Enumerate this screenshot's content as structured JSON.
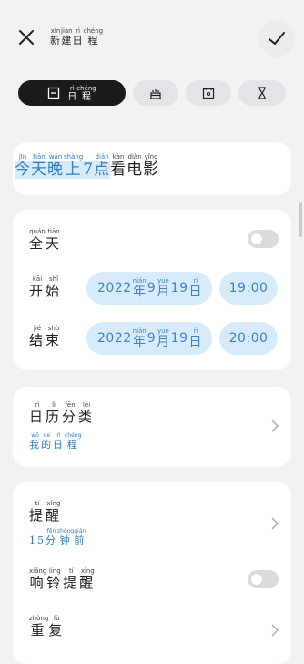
{
  "header": {
    "title": [
      {
        "hanzi": "新",
        "pinyin": "xīn"
      },
      {
        "hanzi": "建",
        "pinyin": "jiàn"
      },
      {
        "hanzi": "日",
        "pinyin": "rì"
      },
      {
        "hanzi": "程",
        "pinyin": "chéng"
      }
    ],
    "close_icon": "close-icon",
    "confirm_icon": "check-icon"
  },
  "tabs": {
    "active_label": "日程",
    "items": [
      {
        "icon": "calendar-square-icon",
        "active": true
      },
      {
        "icon": "birthday-cake-icon",
        "active": false
      },
      {
        "icon": "anniversary-calendar-icon",
        "active": false
      },
      {
        "icon": "hourglass-icon",
        "active": false
      }
    ]
  },
  "event": {
    "title_highlighted": [
      {
        "hanzi": "今",
        "pinyin": "jīn"
      },
      {
        "hanzi": "天",
        "pinyin": "tiān"
      },
      {
        "hanzi": "晚",
        "pinyin": "wǎn"
      },
      {
        "hanzi": "上",
        "pinyin": "shàng"
      },
      {
        "hanzi": "7",
        "pinyin": ""
      },
      {
        "hanzi": "点",
        "pinyin": "diǎn"
      }
    ],
    "title_rest": [
      {
        "hanzi": "看",
        "pinyin": "kàn"
      },
      {
        "hanzi": "电",
        "pinyin": "diàn"
      },
      {
        "hanzi": "影",
        "pinyin": "yǐng"
      }
    ]
  },
  "time": {
    "all_day": [
      {
        "hanzi": "全",
        "pinyin": "quán"
      },
      {
        "hanzi": "天",
        "pinyin": "tiān"
      }
    ],
    "start_label": [
      {
        "hanzi": "开",
        "pinyin": "kāi"
      },
      {
        "hanzi": "始",
        "pinyin": "shǐ"
      }
    ],
    "end_label": [
      {
        "hanzi": "结",
        "pinyin": "jié"
      },
      {
        "hanzi": "束",
        "pinyin": "shù"
      }
    ],
    "start_date": {
      "year": "2022",
      "y": "年",
      "m_num": "9",
      "m": "月",
      "d_num": "19",
      "d": "日",
      "y_py": "nián",
      "m_py": "yuè",
      "d_py": "rì"
    },
    "start_time": "19:00",
    "end_date": {
      "year": "2022",
      "y": "年",
      "m_num": "9",
      "m": "月",
      "d_num": "19",
      "d": "日",
      "y_py": "nián",
      "m_py": "yuè",
      "d_py": "rì"
    },
    "end_time": "20:00",
    "all_day_on": false
  },
  "category": {
    "label": [
      {
        "hanzi": "日",
        "pinyin": "rì"
      },
      {
        "hanzi": "历",
        "pinyin": "lì"
      },
      {
        "hanzi": "分",
        "pinyin": "fēn"
      },
      {
        "hanzi": "类",
        "pinyin": "lèi"
      }
    ],
    "value": [
      {
        "hanzi": "我",
        "pinyin": "wǒ"
      },
      {
        "hanzi": "的",
        "pinyin": "de"
      },
      {
        "hanzi": "日",
        "pinyin": "rì"
      },
      {
        "hanzi": "程",
        "pinyin": "chéng"
      }
    ]
  },
  "reminder": {
    "label": [
      {
        "hanzi": "提",
        "pinyin": "tí"
      },
      {
        "hanzi": "醒",
        "pinyin": "xǐng"
      }
    ],
    "value": [
      {
        "hanzi": "15",
        "pinyin": ""
      },
      {
        "hanzi": "分",
        "pinyin": "fēn"
      },
      {
        "hanzi": "钟",
        "pinyin": "zhōng"
      },
      {
        "hanzi": "前",
        "pinyin": "qián"
      }
    ],
    "ring_label": [
      {
        "hanzi": "响",
        "pinyin": "xiǎng"
      },
      {
        "hanzi": "铃",
        "pinyin": "líng"
      },
      {
        "hanzi": "提",
        "pinyin": "tí"
      },
      {
        "hanzi": "醒",
        "pinyin": "xǐng"
      }
    ],
    "ring_on": false,
    "repeat_label": [
      {
        "hanzi": "重",
        "pinyin": "zhòng"
      },
      {
        "hanzi": "复",
        "pinyin": "fù"
      }
    ]
  },
  "colors": {
    "accent": "#2b7fc3",
    "pill_bg": "#d8ebfb",
    "tab_active": "#1b1b1d",
    "page_bg": "#f2f2f5"
  }
}
